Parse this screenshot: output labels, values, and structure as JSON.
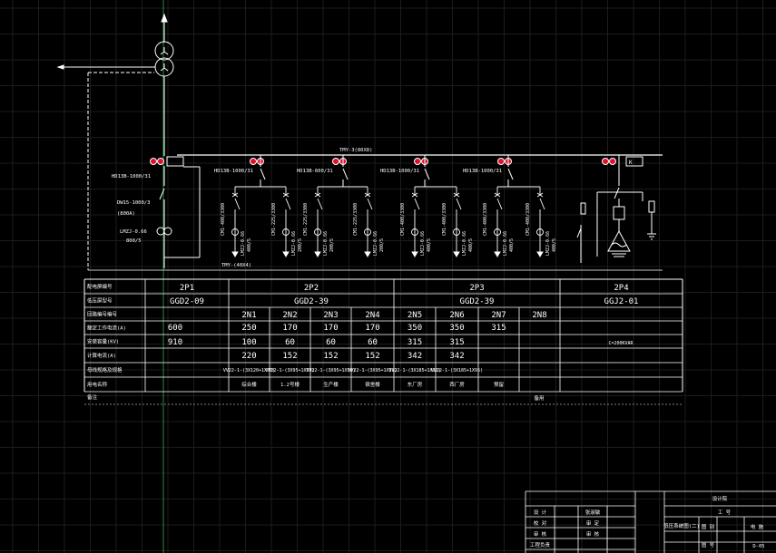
{
  "colors": {
    "background": "#000000",
    "grid": "#1c1c1c",
    "line": "#ffffff",
    "breaker_light": "#e0102a",
    "crosshair": "#2fb34a"
  },
  "diagram": {
    "bus_label": "TMY-3(80X8)",
    "bottom_bus_label": "TMY-(40X4)",
    "incoming": {
      "breaker": "HD13B-1000/31",
      "switch": "DW15-1000/3",
      "switch_rating": "(800A)",
      "ct": "LMZJ-0.66",
      "ct_ratio": "800/5"
    },
    "panel_breakers": [
      "HD13B-1000/31",
      "HD13B-600/31",
      "HD13B-1000/31",
      "HD13B-1000/31"
    ],
    "feeders": [
      {
        "switch": "CM1-400/3300",
        "ct": "LMZJ-0.66",
        "ratio": "400/5"
      },
      {
        "switch": "CM1-225/3300",
        "ct": "LMZJ-0.66",
        "ratio": "200/5"
      },
      {
        "switch": "CM1-225/3300",
        "ct": "LMZJ-0.66",
        "ratio": "200/5"
      },
      {
        "switch": "CM1-225/3300",
        "ct": "LMZJ-0.66",
        "ratio": "200/5"
      },
      {
        "switch": "CM1-400/3300",
        "ct": "LMZJ-0.66",
        "ratio": "400/5"
      },
      {
        "switch": "CM1-400/3300",
        "ct": "LMZJ-0.66",
        "ratio": "400/5"
      },
      {
        "switch": "CM1-400/3300",
        "ct": "LMZJ-0.66",
        "ratio": "400/5"
      },
      {
        "switch": "CM1-400/3300",
        "ct": "LMZJ-0.66",
        "ratio": "400/5"
      }
    ]
  },
  "table": {
    "row_labels": [
      "配电屏编号",
      "低压屏型号",
      "回路编号编号",
      "额定工作电流(A)",
      "安装容量(KV)",
      "计算电流(A)",
      "母线规格及规格",
      "用电名称",
      "备注"
    ],
    "panels": [
      {
        "no": "2P1",
        "model": "GGD2-09"
      },
      {
        "no": "2P2",
        "model": "GGD2-39"
      },
      {
        "no": "2P3",
        "model": "GGD2-39"
      },
      {
        "no": "2P4",
        "model": "GGJ2-01"
      }
    ],
    "circuits": [
      "2N1",
      "2N2",
      "2N3",
      "2N4",
      "2N5",
      "2N6",
      "2N7",
      "2N8"
    ],
    "incoming_current": "600",
    "incoming_capacity": "910",
    "currents": [
      "250",
      "170",
      "170",
      "170",
      "350",
      "350",
      "315",
      ""
    ],
    "capacities": [
      "100",
      "60",
      "60",
      "60",
      "315",
      "315",
      "",
      ""
    ],
    "calc_currents": [
      "220",
      "152",
      "152",
      "152",
      "342",
      "342",
      "",
      ""
    ],
    "cable_specs": [
      "VV22-1-(3X120+1X70)",
      "VV22-1-(3X95+1X50)",
      "VV22-1-(3X95+1X50)",
      "VV22-1-(3X95+1X50)",
      "VV22-1-(3X185+1X95)",
      "VV22-1-(3X185+1X95)",
      "",
      ""
    ],
    "usage": [
      "综合楼",
      "1.2号楼",
      "生产楼",
      "宿舍楼",
      "东厂房",
      "西厂房",
      "预留",
      ""
    ],
    "p4_note": "C=200KVAR",
    "p4_usage": "备用"
  },
  "title_block": {
    "company": "设计院",
    "drawing_title": "低压系统图(二)",
    "rows": [
      "设 计",
      "校 对",
      "审 核",
      "工程负责",
      "工程负责"
    ],
    "signers": [
      "张淑敏",
      "审 定",
      "审 核",
      "",
      "张淑敏"
    ],
    "fields": [
      "工 号",
      "图 别",
      "电 施",
      "图 号",
      "D-05"
    ]
  }
}
